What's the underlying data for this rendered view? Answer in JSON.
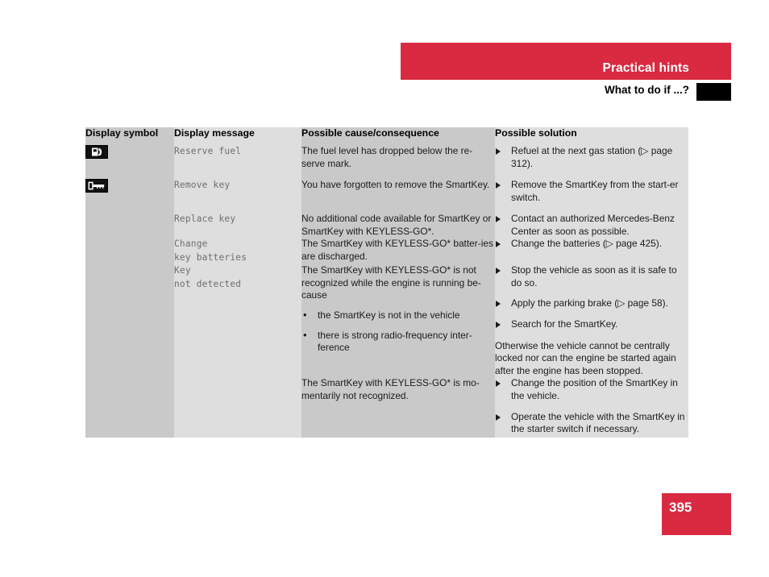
{
  "colors": {
    "brand_red": "#d92a42",
    "header_tab_black": "#000000",
    "cell_dark_gray": "#c9c9c9",
    "cell_light_gray": "#dedede"
  },
  "header": {
    "section_title": "Practical hints",
    "subsection_title": "What to do if ...?"
  },
  "table": {
    "columns": [
      "Display symbol",
      "Display message",
      "Possible cause/consequence",
      "Possible solution"
    ],
    "rows": [
      {
        "symbol_icon": "fuel-pump-icon",
        "message": "Reserve fuel",
        "cause": "The fuel level has dropped below the re-serve mark.",
        "actions": [
          "Refuel at the next gas station (▷ page 312)."
        ],
        "note": ""
      },
      {
        "symbol_icon": "key-icon",
        "message": "Remove key",
        "cause": "You have forgotten to remove the SmartKey.",
        "actions": [
          "Remove the SmartKey from the start-er switch."
        ],
        "note": ""
      },
      {
        "symbol_icon": "",
        "message": "Replace key",
        "cause": "No additional code available for SmartKey or SmartKey with KEYLESS-GO*.",
        "actions": [
          "Contact an authorized Mercedes-Benz Center as soon as possible."
        ],
        "note": ""
      },
      {
        "symbol_icon": "",
        "message": "Change\nkey batteries",
        "cause": "The SmartKey with KEYLESS-GO* batter-ies are discharged.",
        "actions": [
          "Change the batteries (▷ page 425)."
        ],
        "note": ""
      },
      {
        "symbol_icon": "",
        "message": "Key\nnot detected",
        "cause": "The SmartKey with KEYLESS-GO* is not recognized while the engine is running be-cause",
        "cause_bullets": [
          "the SmartKey is not in the vehicle",
          "there is strong radio-frequency inter-ference"
        ],
        "actions": [
          "Stop the vehicle as soon as it is safe to do so.",
          "Apply the parking brake (▷ page 58).",
          "Search for the SmartKey."
        ],
        "note": "Otherwise the vehicle cannot be centrally locked nor can the engine be started again after the engine has been stopped."
      },
      {
        "symbol_icon": "",
        "message": "",
        "cause": "The SmartKey with KEYLESS-GO* is mo-mentarily not recognized.",
        "actions": [
          "Change the position of the SmartKey in the vehicle.",
          "Operate the vehicle with the SmartKey in the starter switch if necessary."
        ],
        "note": ""
      }
    ]
  },
  "footer": {
    "page_number": "395"
  }
}
